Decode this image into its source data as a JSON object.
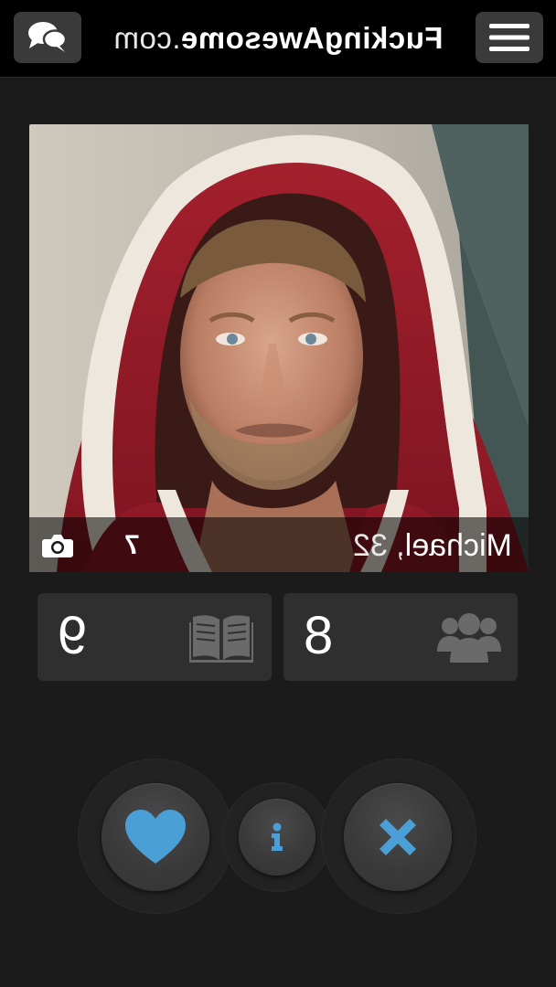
{
  "header": {
    "brand_bold": "FuckingAwesome",
    "brand_light": ".com",
    "chat_icon": "chat-bubbles-icon",
    "menu_icon": "hamburger-menu-icon"
  },
  "profile": {
    "name": "Michael",
    "age": ", 32",
    "photo_count": "7",
    "photo_alt": "profile-photo"
  },
  "stats": {
    "left_value": "9",
    "left_icon": "book-icon",
    "right_value": "8",
    "right_icon": "group-icon"
  },
  "actions": {
    "like_icon": "heart-icon",
    "info_icon": "info-icon",
    "dislike_icon": "close-x-icon"
  },
  "colors": {
    "accent_blue": "#4a9fd6",
    "background": "#1b1b1b",
    "topbar": "#000000",
    "card": "#2f2f2f"
  }
}
